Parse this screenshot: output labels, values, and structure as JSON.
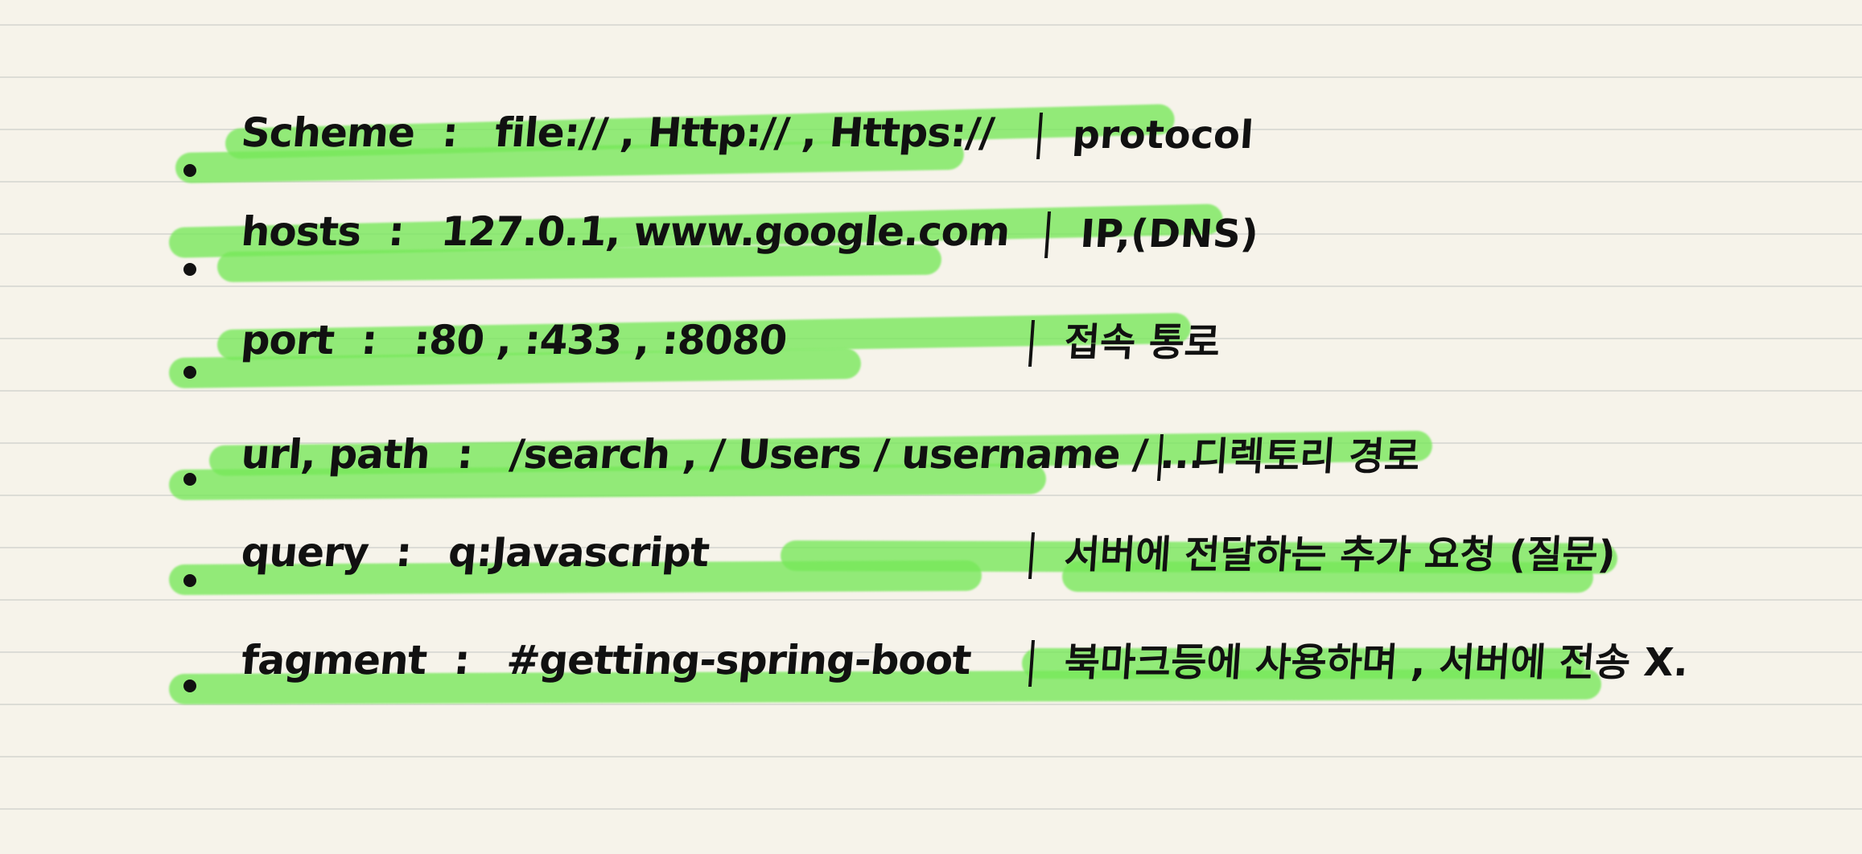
{
  "notes": {
    "items": [
      {
        "label": "Scheme",
        "separator": ":",
        "value": "file:// , Http:// , Https://",
        "note": "protocol"
      },
      {
        "label": "hosts",
        "separator": ":",
        "value": "127.0.1, www.google.com",
        "note": "IP,(DNS)"
      },
      {
        "label": "port",
        "separator": ":",
        "value": ":80 , :433 , :8080",
        "note": "접속 통로"
      },
      {
        "label": "url, path",
        "separator": ":",
        "value": "/search , / Users / username / ...",
        "note": "디렉토리 경로"
      },
      {
        "label": "query",
        "separator": ":",
        "value": "q:Javascript",
        "note": "서버에 전달하는 추가 요청 (질문)"
      },
      {
        "label": "fagment",
        "separator": ":",
        "value": "#getting-spring-boot",
        "note": "북마크등에 사용하며 , 서버에 전송 X."
      }
    ]
  }
}
